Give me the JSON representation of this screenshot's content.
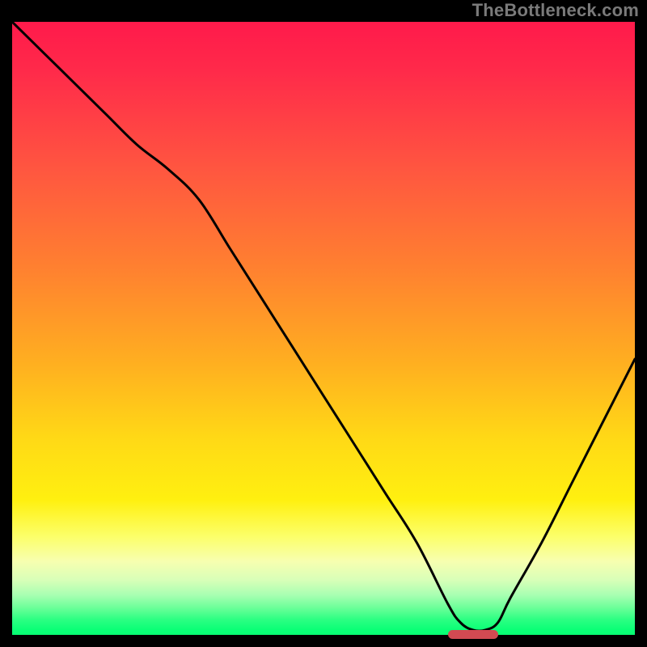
{
  "watermark": "TheBottleneck.com",
  "colors": {
    "background": "#000000",
    "marker": "#d24a52",
    "curve": "#000000",
    "gradient_top": "#ff1a4b",
    "gradient_bottom": "#08ff74"
  },
  "chart_data": {
    "type": "line",
    "title": "",
    "xlabel": "",
    "ylabel": "",
    "xlim": [
      0,
      100
    ],
    "ylim": [
      0,
      100
    ],
    "grid": false,
    "legend": false,
    "marker": {
      "x_start": 70,
      "x_end": 78,
      "y": 0
    },
    "x": [
      0,
      5,
      10,
      15,
      20,
      25,
      30,
      35,
      40,
      45,
      50,
      55,
      60,
      65,
      70,
      72,
      74,
      76,
      78,
      80,
      85,
      90,
      95,
      100
    ],
    "values": [
      100,
      95,
      90,
      85,
      80,
      76,
      71,
      63,
      55,
      47,
      39,
      31,
      23,
      15,
      5,
      2,
      0.8,
      0.8,
      2,
      6,
      15,
      25,
      35,
      45
    ]
  }
}
